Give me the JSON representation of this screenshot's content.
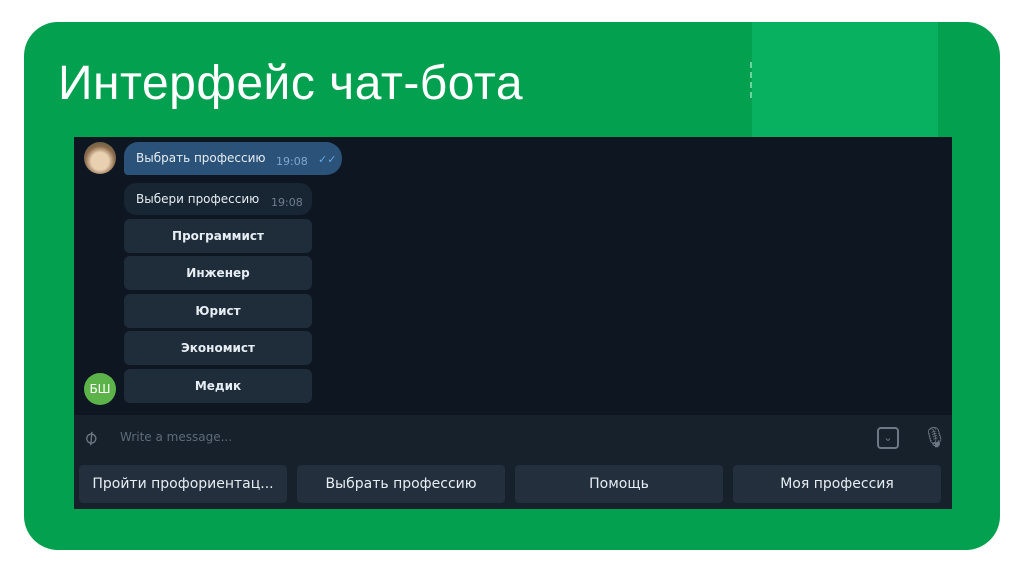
{
  "slide": {
    "title": "Интерфейс чат-бота"
  },
  "chat": {
    "outgoing": {
      "text": "Выбрать профессию",
      "time": "19:08"
    },
    "incoming": {
      "text": "Выбери профессию",
      "time": "19:08"
    },
    "inline_buttons": [
      "Программист",
      "Инженер",
      "Юрист",
      "Экономист",
      "Медик"
    ],
    "bot_avatar": "БШ",
    "input": {
      "placeholder": "Write a message..."
    },
    "reply_buttons": [
      "Пройти профориентац...",
      "Выбрать профессию",
      "Помощь",
      "Моя профессия"
    ]
  }
}
